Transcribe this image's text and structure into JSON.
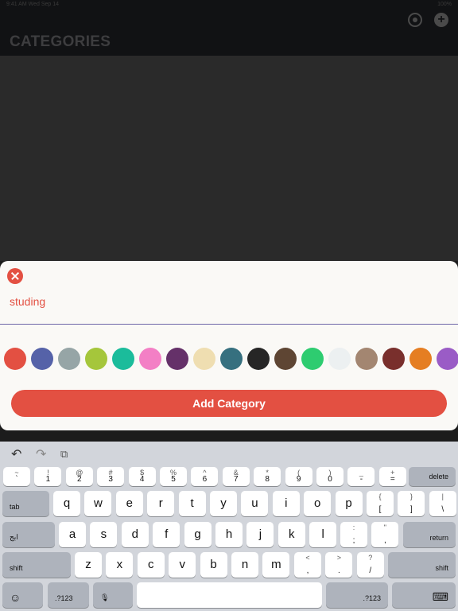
{
  "status": {
    "time": "9:41 AM  Wed Sep 14",
    "battery": "100%"
  },
  "nav": {
    "title": "CATEGORIES",
    "add_symbol": "+"
  },
  "sheet": {
    "input_value": "studing",
    "add_button_label": "Add Category",
    "swatches": [
      {
        "name": "red",
        "color": "#e35042"
      },
      {
        "name": "blue",
        "color": "#5562a8"
      },
      {
        "name": "gray",
        "color": "#96a5a6"
      },
      {
        "name": "lime",
        "color": "#a5c63b"
      },
      {
        "name": "turquoise",
        "color": "#1bbc9b"
      },
      {
        "name": "pink",
        "color": "#f37fc5"
      },
      {
        "name": "plum",
        "color": "#653169"
      },
      {
        "name": "sand",
        "color": "#efdeb1"
      },
      {
        "name": "teal-blue",
        "color": "#36707f"
      },
      {
        "name": "black",
        "color": "#262626"
      },
      {
        "name": "brown",
        "color": "#5e4533"
      },
      {
        "name": "green",
        "color": "#2ecc70"
      },
      {
        "name": "white",
        "color": "#ecf0f1"
      },
      {
        "name": "tan",
        "color": "#a38671"
      },
      {
        "name": "maroon",
        "color": "#792f2c"
      },
      {
        "name": "orange",
        "color": "#e57e22"
      },
      {
        "name": "purple",
        "color": "#9a5cc6"
      }
    ]
  },
  "keyboard": {
    "toolbar": {
      "undo": "↶",
      "redo": "↷",
      "paste": "⧉"
    },
    "number_row": [
      {
        "sym": "~",
        "main": "`"
      },
      {
        "sym": "!",
        "main": "1"
      },
      {
        "sym": "@",
        "main": "2"
      },
      {
        "sym": "#",
        "main": "3"
      },
      {
        "sym": "$",
        "main": "4"
      },
      {
        "sym": "%",
        "main": "5"
      },
      {
        "sym": "^",
        "main": "6"
      },
      {
        "sym": "&",
        "main": "7"
      },
      {
        "sym": "*",
        "main": "8"
      },
      {
        "sym": "(",
        "main": "9"
      },
      {
        "sym": ")",
        "main": "0"
      },
      {
        "sym": "_",
        "main": "-"
      },
      {
        "sym": "+",
        "main": "="
      }
    ],
    "delete": "delete",
    "tab": "tab",
    "row1": [
      "q",
      "w",
      "e",
      "r",
      "t",
      "y",
      "u",
      "i",
      "o",
      "p"
    ],
    "row1_sym": [
      {
        "sym": "{",
        "main": "["
      },
      {
        "sym": "}",
        "main": "]"
      },
      {
        "sym": "|",
        "main": "\\"
      }
    ],
    "lang": "ابج",
    "row2": [
      "a",
      "s",
      "d",
      "f",
      "g",
      "h",
      "j",
      "k",
      "l"
    ],
    "row2_sym": [
      {
        "sym": ":",
        "main": ";"
      },
      {
        "sym": "\"",
        "main": ","
      }
    ],
    "return": "return",
    "shift": "shift",
    "row3": [
      "z",
      "x",
      "c",
      "v",
      "b",
      "n",
      "m"
    ],
    "row3_sym": [
      {
        "sym": "<",
        "main": ","
      },
      {
        "sym": ">",
        "main": "."
      },
      {
        "sym": "?",
        "main": "/"
      }
    ],
    "emoji": "☺",
    "numbers_left": ".?123",
    "mic": "🎙",
    "numbers_right": ".?123",
    "hide": "⌨"
  }
}
